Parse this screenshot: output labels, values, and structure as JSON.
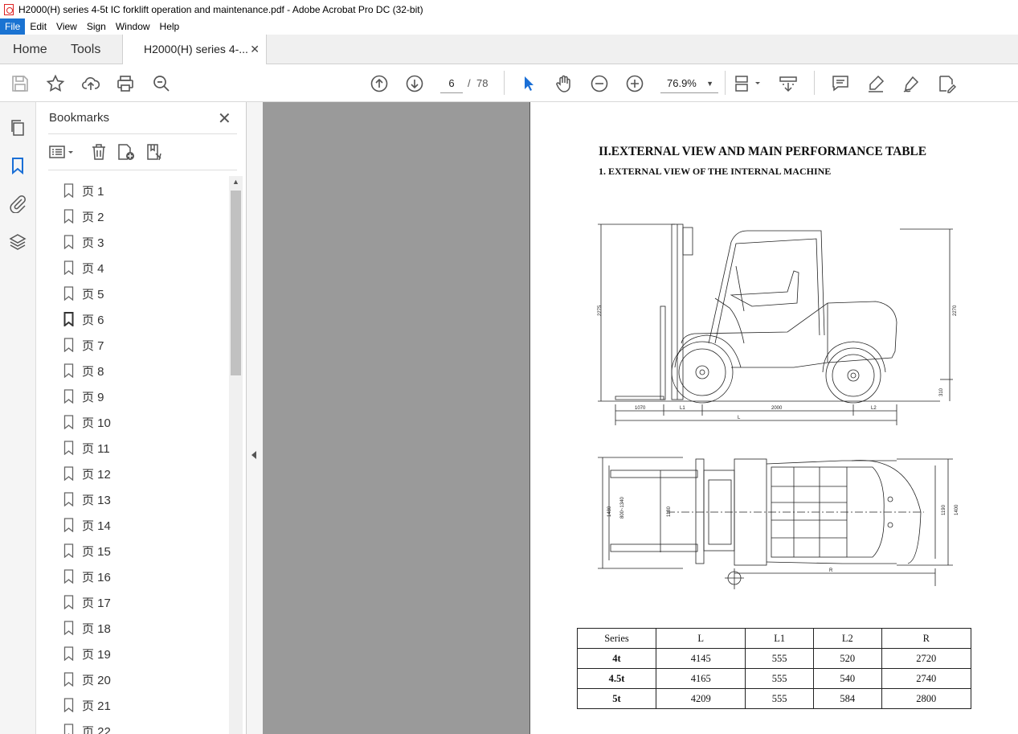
{
  "window": {
    "title": "H2000(H) series 4-5t IC forklift operation and maintenance.pdf - Adobe Acrobat Pro DC (32-bit)"
  },
  "menu": [
    "File",
    "Edit",
    "View",
    "Sign",
    "Window",
    "Help"
  ],
  "tabs": {
    "home": "Home",
    "tools": "Tools",
    "document": "H2000(H) series 4-..."
  },
  "toolbar": {
    "current_page": "6",
    "page_separator": "/",
    "total_pages": "78",
    "zoom": "76.9%"
  },
  "bookmarks": {
    "header": "Bookmarks",
    "items": [
      "页 1",
      "页 2",
      "页 3",
      "页 4",
      "页 5",
      "页 6",
      "页 7",
      "页 8",
      "页 9",
      "页 10",
      "页 11",
      "页 12",
      "页 13",
      "页 14",
      "页 15",
      "页 16",
      "页 17",
      "页 18",
      "页 19",
      "页 20",
      "页 21",
      "页 22"
    ],
    "current_index": 5
  },
  "document": {
    "heading": "II.EXTERNAL VIEW AND MAIN PERFORMANCE TABLE",
    "subheading": "1. EXTERNAL VIEW OF THE INTERNAL MACHINE",
    "drawing_labels": {
      "side_height_left": "2275",
      "side_height_right": "2270",
      "clearance": "310",
      "fork_length": "1070",
      "l1": "L1",
      "wheelbase": "2000",
      "l2": "L2",
      "l": "L",
      "top_width": "1480",
      "fork_spread": "800~1340",
      "front_tread": "1180",
      "rear_tread": "1190",
      "overall_width": "1400",
      "radius": "R"
    },
    "table": {
      "headers": [
        "Series",
        "L",
        "L1",
        "L2",
        "R"
      ],
      "rows": [
        [
          "4t",
          "4145",
          "555",
          "520",
          "2720"
        ],
        [
          "4.5t",
          "4165",
          "555",
          "540",
          "2740"
        ],
        [
          "5t",
          "4209",
          "555",
          "584",
          "2800"
        ]
      ]
    }
  }
}
